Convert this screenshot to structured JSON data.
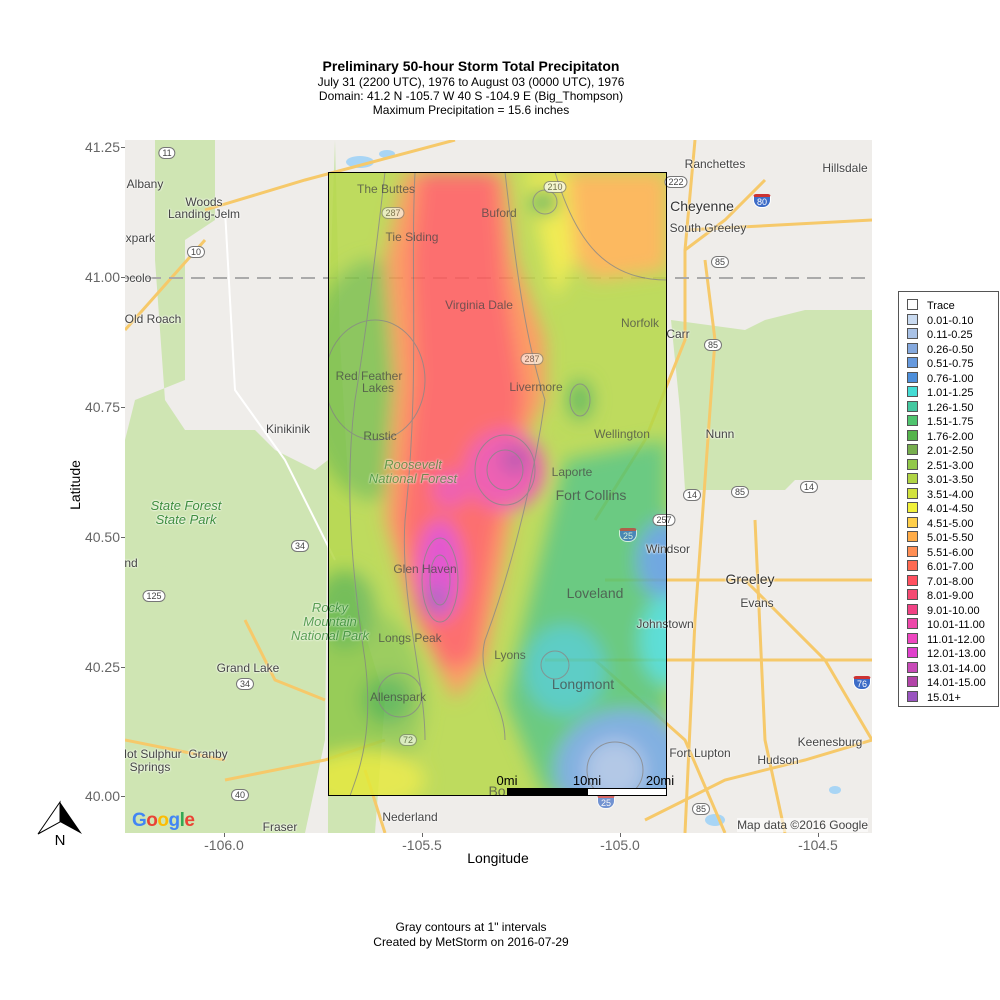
{
  "title": "Preliminary 50-hour Storm Total Precipitaton",
  "subtitles": [
    "July 31 (2200 UTC), 1976 to August 03 (0000 UTC), 1976",
    "Domain: 41.2 N -105.7 W 40 S -104.9 E (Big_Thompson)",
    "Maximum Precipitation = 15.6 inches"
  ],
  "axes": {
    "xlabel": "Longitude",
    "ylabel": "Latitude",
    "xticks": [
      "-106.0",
      "-105.5",
      "-105.0",
      "-104.5"
    ],
    "yticks": [
      "41.25",
      "41.00",
      "40.75",
      "40.50",
      "40.25",
      "40.00"
    ],
    "xlim": [
      -106.25,
      -104.42
    ],
    "ylim": [
      39.93,
      41.27
    ]
  },
  "legend": {
    "items": [
      {
        "label": "Trace",
        "color": "#ffffff"
      },
      {
        "label": "0.01-0.10",
        "color": "#c9daf0"
      },
      {
        "label": "0.11-0.25",
        "color": "#a9c2e6"
      },
      {
        "label": "0.26-0.50",
        "color": "#85a9de"
      },
      {
        "label": "0.51-0.75",
        "color": "#6699dd"
      },
      {
        "label": "0.76-1.00",
        "color": "#4d8fdb"
      },
      {
        "label": "1.01-1.25",
        "color": "#44dcd4"
      },
      {
        "label": "1.26-1.50",
        "color": "#44c8a0"
      },
      {
        "label": "1.51-1.75",
        "color": "#4fc46e"
      },
      {
        "label": "1.76-2.00",
        "color": "#55b44c"
      },
      {
        "label": "2.01-2.50",
        "color": "#77ae4e"
      },
      {
        "label": "2.51-3.00",
        "color": "#92c84a"
      },
      {
        "label": "3.01-3.50",
        "color": "#b0d444"
      },
      {
        "label": "3.51-4.00",
        "color": "#d2e23e"
      },
      {
        "label": "4.01-4.50",
        "color": "#f2f23a"
      },
      {
        "label": "4.51-5.00",
        "color": "#ffcf4a"
      },
      {
        "label": "5.01-5.50",
        "color": "#ffac48"
      },
      {
        "label": "5.51-6.00",
        "color": "#ff8e54"
      },
      {
        "label": "6.01-7.00",
        "color": "#ff6a52"
      },
      {
        "label": "7.01-8.00",
        "color": "#ff5060"
      },
      {
        "label": "8.01-9.00",
        "color": "#f54a72"
      },
      {
        "label": "9.01-10.00",
        "color": "#f04284"
      },
      {
        "label": "10.01-11.00",
        "color": "#ee48aa"
      },
      {
        "label": "11.01-12.00",
        "color": "#ee46c0"
      },
      {
        "label": "12.01-13.00",
        "color": "#e040cc"
      },
      {
        "label": "13.01-14.00",
        "color": "#c84ab8"
      },
      {
        "label": "14.01-15.00",
        "color": "#b244a8"
      },
      {
        "label": "15.01+",
        "color": "#9a55c0"
      }
    ]
  },
  "map": {
    "labels": [
      "Albany",
      "Woods",
      "Landing-Jelm",
      "oxpark",
      "ocolo",
      "Old Roach",
      "Kinikinik",
      "nd",
      "Grand Lake",
      "Hot Sulphur",
      "Springs",
      "Granby",
      "Fraser",
      "Nederland",
      "The Buttes",
      "Tie Siding",
      "Buford",
      "Virginia Dale",
      "Red Feather",
      "Lakes",
      "Rustic",
      "Livermore",
      "Norfolk",
      "Carr",
      "Wellington",
      "Nunn",
      "Laporte",
      "Fort Collins",
      "Windsor",
      "Greeley",
      "Evans",
      "Loveland",
      "Johnstown",
      "Glen Haven",
      "Longs Peak",
      "Allenspark",
      "Lyons",
      "Longmont",
      "Fort Lupton",
      "Hudson",
      "Keenesburg",
      "Ranchettes",
      "Hillsdale",
      "Cheyenne",
      "South Greeley",
      "Bo"
    ],
    "parks": [
      "State Forest",
      "State Park",
      "Roosevelt",
      "National Forest",
      "Rocky",
      "Mountain",
      "National Park"
    ],
    "shields": [
      "11",
      "10",
      "287",
      "210",
      "222",
      "80",
      "85",
      "85",
      "14",
      "14",
      "85",
      "34",
      "125",
      "34",
      "40",
      "72",
      "25",
      "257",
      "287",
      "76",
      "85",
      "25"
    ],
    "attribution": "Map data ©2016 Google",
    "logo": "Google"
  },
  "scale_bar": {
    "labels": [
      "0mi",
      "10mi",
      "20mi"
    ]
  },
  "north_arrow": "N",
  "footer": [
    "Gray contours at 1\" intervals",
    "Created by MetStorm on 2016-07-29"
  ]
}
